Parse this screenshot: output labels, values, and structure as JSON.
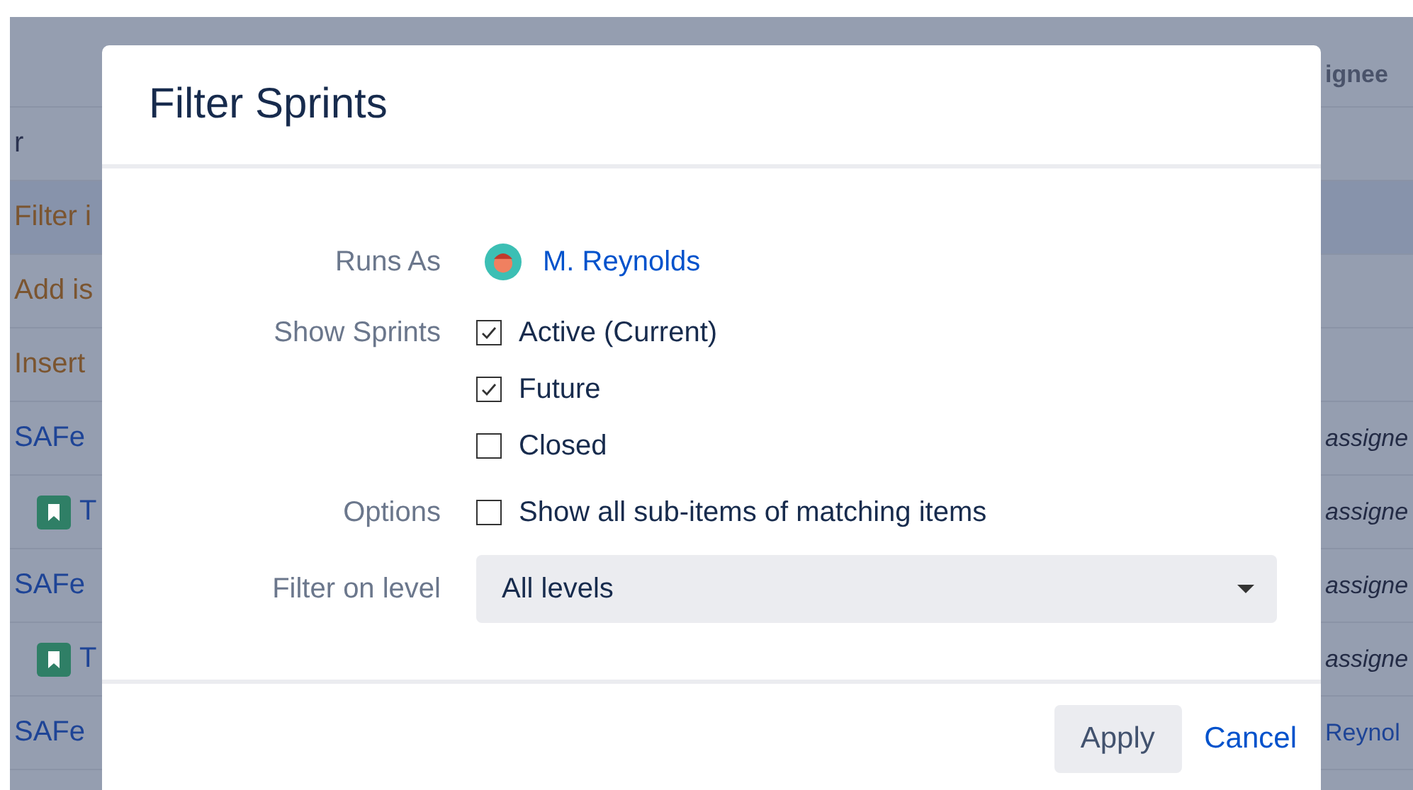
{
  "background_table": {
    "rows": [
      {
        "kind": "header",
        "selected": false,
        "left": "",
        "right": "ignee"
      },
      {
        "kind": "plain",
        "selected": false,
        "left": "r",
        "right": ""
      },
      {
        "kind": "action",
        "selected": true,
        "left": "Filter i",
        "right": ""
      },
      {
        "kind": "action",
        "selected": false,
        "left": "Add is",
        "right": ""
      },
      {
        "kind": "action",
        "selected": false,
        "left": "Insert",
        "right": ""
      },
      {
        "kind": "link",
        "selected": false,
        "left": "SAFe",
        "right": "assigne"
      },
      {
        "kind": "story",
        "selected": false,
        "left": "T",
        "right": "assigne"
      },
      {
        "kind": "link",
        "selected": false,
        "left": "SAFe",
        "right": "assigne"
      },
      {
        "kind": "story",
        "selected": false,
        "left": "T",
        "right": "assigne"
      },
      {
        "kind": "user",
        "selected": false,
        "left": "SAFe",
        "right": "Reynol"
      }
    ]
  },
  "dialog": {
    "title": "Filter Sprints",
    "runs_as": {
      "label": "Runs As",
      "user": "M. Reynolds"
    },
    "show_sprints": {
      "label": "Show Sprints",
      "options": [
        {
          "label": "Active (Current)",
          "checked": true
        },
        {
          "label": "Future",
          "checked": true
        },
        {
          "label": "Closed",
          "checked": false
        }
      ]
    },
    "options": {
      "label": "Options",
      "items": [
        {
          "label": "Show all sub-items of matching items",
          "checked": false
        }
      ]
    },
    "filter_on_level": {
      "label": "Filter on level",
      "value": "All levels"
    },
    "buttons": {
      "apply": "Apply",
      "cancel": "Cancel"
    }
  }
}
